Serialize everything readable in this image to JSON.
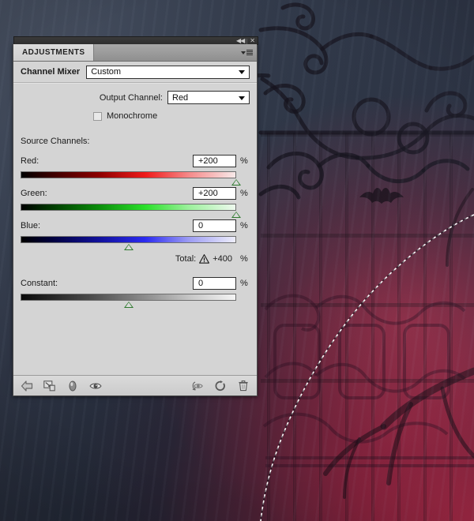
{
  "window": {
    "collapse_label": "◀◀",
    "close_label": "✕"
  },
  "panel": {
    "tab_label": "ADJUSTMENTS",
    "menu_icon": "panel-menu-icon",
    "preset": {
      "label": "Channel Mixer",
      "value": "Custom"
    },
    "output_channel": {
      "label": "Output Channel:",
      "value": "Red"
    },
    "monochrome": {
      "label": "Monochrome",
      "checked": false
    },
    "source_channels_label": "Source Channels:",
    "channels": [
      {
        "name": "Red:",
        "value": "+200",
        "unit": "%",
        "thumb_pct": 100,
        "track": "red"
      },
      {
        "name": "Green:",
        "value": "+200",
        "unit": "%",
        "thumb_pct": 100,
        "track": "green"
      },
      {
        "name": "Blue:",
        "value": "0",
        "unit": "%",
        "thumb_pct": 50,
        "track": "blue"
      }
    ],
    "total": {
      "label": "Total:",
      "warning_icon": "warning-triangle-icon",
      "value": "+400",
      "unit": "%"
    },
    "constant": {
      "name": "Constant:",
      "value": "0",
      "unit": "%",
      "thumb_pct": 50
    },
    "footer_icons": [
      "return-to-adjustment-list-icon",
      "clip-to-layer-icon",
      "toggle-mask-icon",
      "toggle-layer-visibility-icon",
      "view-previous-state-icon",
      "reset-adjustment-icon",
      "delete-adjustment-icon"
    ]
  },
  "colors": {
    "panel_bg": "#d4d4d4",
    "tab_bg": "#dcdcdc",
    "titlebar_bg": "#2d2d2d",
    "slider_thumb": "#2f7a2f",
    "backdrop_blue": "#2f3747",
    "backdrop_red": "#af2644"
  }
}
